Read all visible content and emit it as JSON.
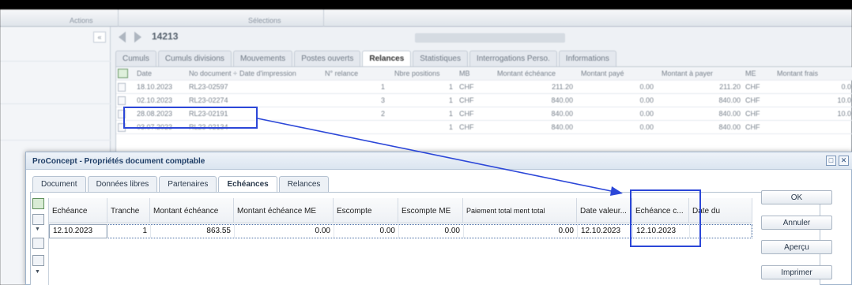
{
  "ribbon": {
    "actions_label": "Actions",
    "selections_label": "Sélections"
  },
  "left_panel": {
    "collapse_glyph": "«"
  },
  "nav": {
    "prev_icon": "arrow-left-icon",
    "next_icon": "arrow-right-icon",
    "document_number": "14213"
  },
  "main_tabs": [
    {
      "label": "Cumuls"
    },
    {
      "label": "Cumuls divisions"
    },
    {
      "label": "Mouvements"
    },
    {
      "label": "Postes ouverts"
    },
    {
      "label": "Relances"
    },
    {
      "label": "Statistiques"
    },
    {
      "label": "Interrogations Perso."
    },
    {
      "label": "Informations"
    }
  ],
  "relances_grid": {
    "headers": [
      "Date",
      "No document ÷",
      "Date d'impression",
      "N° relance",
      "Nbre positions",
      "MB",
      "Montant échéance",
      "Montant payé",
      "Montant à payer",
      "ME",
      "Montant frais"
    ],
    "rows": [
      {
        "date": "18.10.2023",
        "doc": "RL23-02597",
        "relance": "1",
        "positions": "1",
        "mb": "CHF",
        "montant": "211.20",
        "paye": "0.00",
        "apayer": "211.20",
        "me": "CHF",
        "frais": "0.0"
      },
      {
        "date": "02.10.2023",
        "doc": "RL23-02274",
        "relance": "3",
        "positions": "1",
        "mb": "CHF",
        "montant": "840.00",
        "paye": "0.00",
        "apayer": "840.00",
        "me": "CHF",
        "frais": "10.0"
      },
      {
        "date": "28.08.2023",
        "doc": "RL23-02191",
        "relance": "2",
        "positions": "1",
        "mb": "CHF",
        "montant": "840.00",
        "paye": "0.00",
        "apayer": "840.00",
        "me": "CHF",
        "frais": "10.0"
      },
      {
        "date": "03.07.2023",
        "doc": "RL23-02134",
        "relance": "",
        "positions": "1",
        "mb": "CHF",
        "montant": "840.00",
        "paye": "0.00",
        "apayer": "840.00",
        "me": "CHF",
        "frais": "0.0"
      }
    ]
  },
  "dialog": {
    "title": "ProConcept - Propriétés document comptable",
    "tabs": [
      {
        "label": "Document"
      },
      {
        "label": "Données libres"
      },
      {
        "label": "Partenaires"
      },
      {
        "label": "Echéances"
      },
      {
        "label": "Relances"
      }
    ],
    "grid": {
      "headers": [
        "Echéance",
        "Tranche",
        "Montant échéance",
        "Montant échéance ME",
        "Escompte",
        "Escompte ME",
        "Paiement total ment total",
        "Date valeur...",
        "Echéance c...",
        "Date du"
      ],
      "row": {
        "echeance": "12.10.2023",
        "tranche": "1",
        "montant": "863.55",
        "montant_me": "0.00",
        "escompte": "0.00",
        "escompte_me": "0.00",
        "paiement_total": "0.00",
        "date_valeur": "12.10.2023",
        "echeance_c": "12.10.2023",
        "date_du": ""
      }
    },
    "buttons": {
      "ok": "OK",
      "cancel": "Annuler",
      "preview": "Aperçu",
      "print": "Imprimer"
    }
  },
  "colors": {
    "highlight": "#2c47d8",
    "dialog_title": "#1e3d66"
  }
}
